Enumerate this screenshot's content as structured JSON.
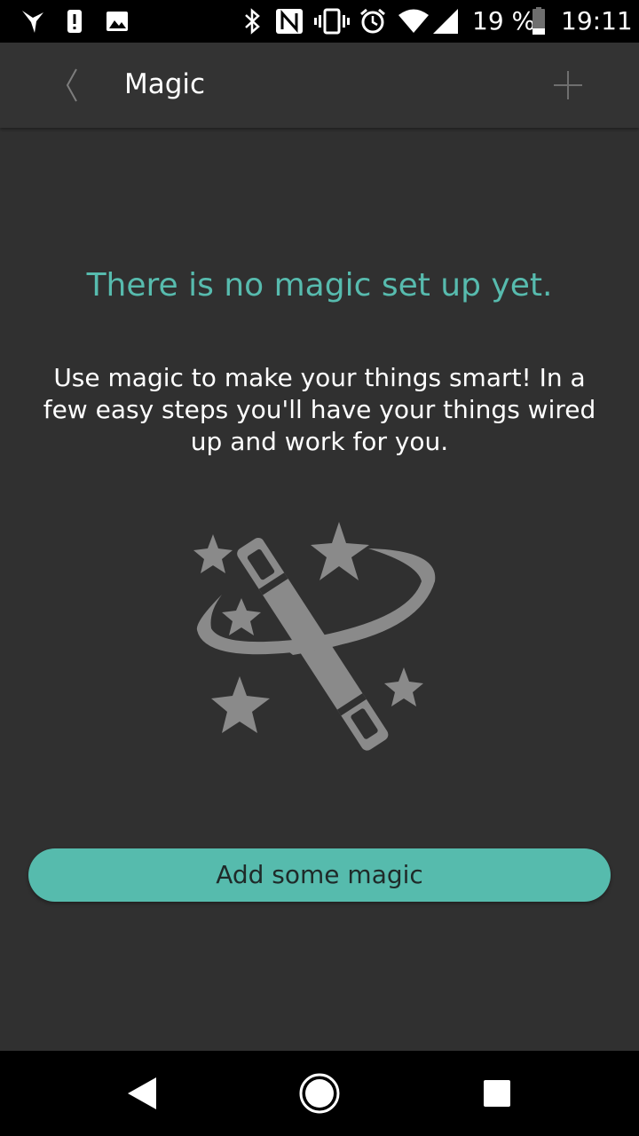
{
  "status_bar": {
    "battery_percent": "19 %",
    "time": "19:11",
    "icons": [
      "bird-icon",
      "alert-icon",
      "image-icon",
      "bluetooth-icon",
      "nfc-icon",
      "vibrate-icon",
      "alarm-icon",
      "wifi-icon",
      "signal-icon",
      "battery-icon"
    ]
  },
  "app_bar": {
    "title": "Magic",
    "back_icon": "chevron-left-icon",
    "add_icon": "plus-icon"
  },
  "empty_state": {
    "title": "There is no magic set up yet.",
    "description": "Use magic to make your things smart! In a few easy steps you'll have your things wired up and work for you.",
    "illustration": "magic-wand-icon",
    "button_label": "Add some magic"
  },
  "nav_bar": {
    "icons": [
      "back-triangle-icon",
      "home-circle-icon",
      "recents-square-icon"
    ]
  },
  "colors": {
    "background": "#303030",
    "app_bar": "#333333",
    "accent": "#56bbad",
    "illustration": "#8a8a8a"
  }
}
